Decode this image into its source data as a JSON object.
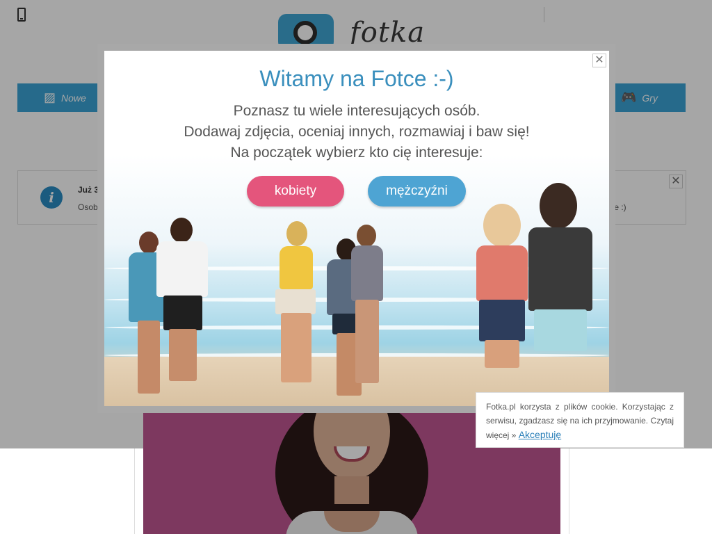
{
  "logo": {
    "text": "fotka"
  },
  "nav": {
    "nowe": {
      "label": "Nowe",
      "icon": "image-icon"
    },
    "gry": {
      "label": "Gry",
      "icon": "gamepad-icon"
    }
  },
  "notice": {
    "title": "Już 3",
    "text": "Osob",
    "text_right": "pie :)"
  },
  "modal": {
    "title": "Witamy na Fotce :-)",
    "line1": "Poznasz tu wiele interesujących osób.",
    "line2": "Dodawaj zdjęcia, oceniaj innych, rozmawiaj i baw się!",
    "line3": "Na początek wybierz kto cię interesuje:",
    "btn_women": "kobiety",
    "btn_men": "mężczyźni",
    "close": "✕"
  },
  "cookie": {
    "text": "Fotka.pl korzysta z plików cookie. Korzystając z serwisu, zgadzasz się na ich przyjmowanie. Czytaj więcej »",
    "accept": "Akceptuję"
  },
  "colors": {
    "accent": "#3ba4d6",
    "women_button": "#e4557c",
    "men_button": "#4ea4d3",
    "title": "#3a8fbd"
  }
}
